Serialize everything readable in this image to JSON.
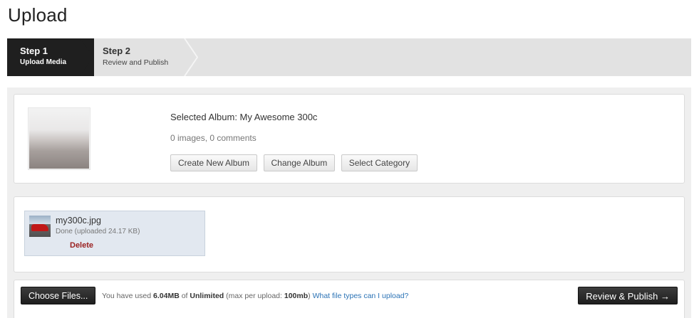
{
  "page": {
    "title": "Upload"
  },
  "steps": [
    {
      "label": "Step 1",
      "sub": "Upload Media"
    },
    {
      "label": "Step 2",
      "sub": "Review and Publish"
    }
  ],
  "album": {
    "selected_label": "Selected Album: My Awesome 300c",
    "counts": "0 images, 0 comments",
    "buttons": {
      "create": "Create New Album",
      "change": "Change Album",
      "category": "Select Category"
    }
  },
  "files": [
    {
      "name": "my300c.jpg",
      "status": "Done (uploaded 24.17 KB)",
      "delete_label": "Delete"
    }
  ],
  "footer": {
    "choose_label": "Choose Files...",
    "usage_prefix": "You have used ",
    "used": "6.04MB",
    "of": " of ",
    "limit": "Unlimited",
    "max_prefix": " (max per upload: ",
    "max": "100mb",
    "max_suffix": ")",
    "help_link": "What file types can I upload?",
    "publish_label": "Review & Publish →"
  },
  "colors": {
    "active_step": "#1f1f1f",
    "steps_bg": "#e2e2e2",
    "link": "#2a72b5",
    "delete": "#9b2222",
    "file_item_bg": "#e2e8f0"
  },
  "icons": {
    "step_chevron": "chevron-right-icon",
    "publish_arrow": "arrow-right-icon"
  }
}
